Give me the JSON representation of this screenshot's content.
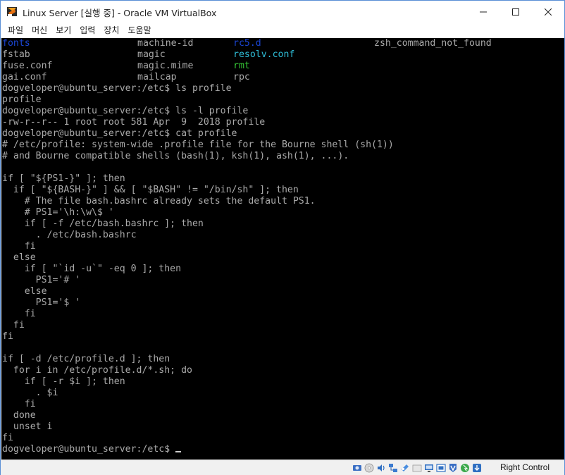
{
  "window": {
    "title": "Linux Server [실행 중] - Oracle VM VirtualBox"
  },
  "menu": {
    "items": [
      "파일",
      "머신",
      "보기",
      "입력",
      "장치",
      "도움말"
    ]
  },
  "terminal": {
    "lines": [
      {
        "cols": [
          {
            "text": "fonts",
            "color": "blue"
          },
          {
            "text": "machine-id",
            "color": "default"
          },
          {
            "text": "rc5.d",
            "color": "blue"
          },
          {
            "text": "zsh_command_not_found",
            "color": "default"
          }
        ]
      },
      {
        "cols": [
          {
            "text": "fstab",
            "color": "default"
          },
          {
            "text": "magic",
            "color": "default"
          },
          {
            "text": "resolv.conf",
            "color": "cyan"
          },
          {
            "text": "",
            "color": "default"
          }
        ]
      },
      {
        "cols": [
          {
            "text": "fuse.conf",
            "color": "default"
          },
          {
            "text": "magic.mime",
            "color": "default"
          },
          {
            "text": "rmt",
            "color": "green"
          },
          {
            "text": "",
            "color": "default"
          }
        ]
      },
      {
        "cols": [
          {
            "text": "gai.conf",
            "color": "default"
          },
          {
            "text": "mailcap",
            "color": "default"
          },
          {
            "text": "rpc",
            "color": "default"
          },
          {
            "text": "",
            "color": "default"
          }
        ]
      },
      {
        "text": "dogveloper@ubuntu_server:/etc$ ls profile"
      },
      {
        "text": "profile"
      },
      {
        "text": "dogveloper@ubuntu_server:/etc$ ls -l profile"
      },
      {
        "text": "-rw-r--r-- 1 root root 581 Apr  9  2018 profile"
      },
      {
        "text": "dogveloper@ubuntu_server:/etc$ cat profile"
      },
      {
        "text": "# /etc/profile: system-wide .profile file for the Bourne shell (sh(1))"
      },
      {
        "text": "# and Bourne compatible shells (bash(1), ksh(1), ash(1), ...)."
      },
      {
        "text": ""
      },
      {
        "text": "if [ \"${PS1-}\" ]; then"
      },
      {
        "text": "  if [ \"${BASH-}\" ] && [ \"$BASH\" != \"/bin/sh\" ]; then"
      },
      {
        "text": "    # The file bash.bashrc already sets the default PS1."
      },
      {
        "text": "    # PS1='\\h:\\w\\$ '"
      },
      {
        "text": "    if [ -f /etc/bash.bashrc ]; then"
      },
      {
        "text": "      . /etc/bash.bashrc"
      },
      {
        "text": "    fi"
      },
      {
        "text": "  else"
      },
      {
        "text": "    if [ \"`id -u`\" -eq 0 ]; then"
      },
      {
        "text": "      PS1='# '"
      },
      {
        "text": "    else"
      },
      {
        "text": "      PS1='$ '"
      },
      {
        "text": "    fi"
      },
      {
        "text": "  fi"
      },
      {
        "text": "fi"
      },
      {
        "text": ""
      },
      {
        "text": "if [ -d /etc/profile.d ]; then"
      },
      {
        "text": "  for i in /etc/profile.d/*.sh; do"
      },
      {
        "text": "    if [ -r $i ]; then"
      },
      {
        "text": "      . $i"
      },
      {
        "text": "    fi"
      },
      {
        "text": "  done"
      },
      {
        "text": "  unset i"
      },
      {
        "text": "fi"
      },
      {
        "text": "dogveloper@ubuntu_server:/etc$ "
      }
    ],
    "colors": {
      "default": "#aaaaaa",
      "blue": "#1a45d4",
      "cyan": "#2fbfd9",
      "green": "#36c936",
      "background": "#000000"
    }
  },
  "statusbar": {
    "icons": [
      "hard-disk-icon",
      "optical-drive-icon",
      "audio-icon",
      "network-icon",
      "usb-icon",
      "shared-folders-icon",
      "display-icon",
      "video-capture-icon",
      "virtualization-icon",
      "mouse-integration-icon"
    ],
    "host_key_label": "Right Control"
  }
}
